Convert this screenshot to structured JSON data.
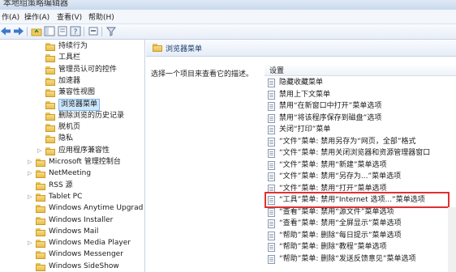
{
  "window": {
    "title": "本地组策略编辑器"
  },
  "menu": {
    "items": [
      "作(A)",
      "操作(A)",
      "查看(V)",
      "帮助(H)"
    ]
  },
  "tree": {
    "items": [
      {
        "label": "持续行为",
        "arrow": "",
        "indent": 1
      },
      {
        "label": "工具栏",
        "arrow": "",
        "indent": 1
      },
      {
        "label": "管理员认可的控件",
        "arrow": "",
        "indent": 1
      },
      {
        "label": "加速器",
        "arrow": "",
        "indent": 1
      },
      {
        "label": "兼容性视图",
        "arrow": "",
        "indent": 1
      },
      {
        "label": "浏览器菜单",
        "arrow": "",
        "indent": 1,
        "selected": true
      },
      {
        "label": "删除浏览的历史记录",
        "arrow": "",
        "indent": 1
      },
      {
        "label": "脱机页",
        "arrow": "",
        "indent": 1
      },
      {
        "label": "隐私",
        "arrow": "",
        "indent": 1
      },
      {
        "label": "应用程序兼容性",
        "arrow": "▷",
        "indent": 1
      },
      {
        "label": "Microsoft 管理控制台",
        "arrow": "▷",
        "indent": 0
      },
      {
        "label": "NetMeeting",
        "arrow": "▷",
        "indent": 0
      },
      {
        "label": "RSS 源",
        "arrow": "",
        "indent": 0
      },
      {
        "label": "Tablet PC",
        "arrow": "▷",
        "indent": 0
      },
      {
        "label": "Windows Anytime Upgrad",
        "arrow": "",
        "indent": 0
      },
      {
        "label": "Windows Installer",
        "arrow": "",
        "indent": 0
      },
      {
        "label": "Windows Mail",
        "arrow": "",
        "indent": 0
      },
      {
        "label": "Windows Media Player",
        "arrow": "▷",
        "indent": 0
      },
      {
        "label": "Windows Messenger",
        "arrow": "",
        "indent": 0
      },
      {
        "label": "Windows SideShow",
        "arrow": "",
        "indent": 0
      }
    ]
  },
  "panel": {
    "title": "浏览器菜单",
    "description": "选择一个项目来查看它的描述。",
    "column_header": "设置"
  },
  "settings": [
    "隐藏收藏菜单",
    "禁用上下文菜单",
    "禁用“在新窗口中打开”菜单选项",
    "禁用“将该程序保存到磁盘”选项",
    "关闭“打印”菜单",
    "“文件”菜单: 禁用另存为“网页，全部”格式",
    "“文件”菜单: 禁用关闭浏览器和资源管理器窗口",
    "“文件”菜单: 禁用“新建”菜单选项",
    "“文件”菜单: 禁用“另存为...”菜单选项",
    "“文件”菜单: 禁用“打开”菜单选项",
    "“工具”菜单: 禁用“Internet 选项...”菜单选项",
    "“查看”菜单: 禁用“源文件”菜单选项",
    "“查看”菜单: 禁用“全屏显示”菜单选项",
    "“帮助”菜单: 删除“每日提示”菜单选项",
    "“帮助”菜单: 删除“教程”菜单选项",
    "“帮助”菜单: 删除“发送反馈意见”菜单选项"
  ],
  "colors": {
    "highlight": "#e03030",
    "selection": "#cde8ff",
    "folder": "#f0cc5e"
  }
}
